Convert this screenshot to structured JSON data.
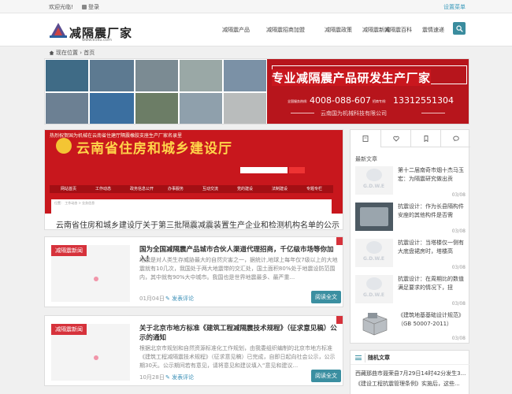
{
  "topbar": {
    "welcome": "欢迎光临!",
    "login": "登录",
    "settings_menu": "设置菜单"
  },
  "logo": {
    "site_name": "减隔震厂家",
    "url_text": "www.e5ku.com"
  },
  "nav": {
    "items": [
      "减隔震产品",
      "减隔震招商加盟",
      "减隔震政策",
      "减隔震新闻",
      "减隔震百科",
      "震情速递"
    ]
  },
  "breadcrumb": {
    "prefix": "现在位置",
    "home": "首页"
  },
  "banner": {
    "headline": "专业减隔震产品研发生产厂家",
    "phone_label_1": "全国服务热线:",
    "phone_1": "4008-088-607",
    "phone_label_2": "招商专线:",
    "phone_2": "13312551304",
    "company": "云南国为机械科技有限公司"
  },
  "featured": {
    "image_top_text": "热烈祝贺国为机械在云南省住建厅隔震橡胶支座生产厂家名录里",
    "image_gov_text": "云南省住房和城乡建设厅",
    "image_menu": [
      "网站首页",
      "工作动态",
      "政务信息公开",
      "办事服务",
      "互动交流",
      "党的建设",
      "法制建设",
      "专题专栏"
    ],
    "image_crumb": "位置： 工作动态 > 业务信息",
    "title": "云南省住房和城乡建设厅关于第三批隔震减震装置生产企业和检测机构名单的公示"
  },
  "posts": [
    {
      "category": "减隔震新闻",
      "title": "国为全国减隔震产品城市合伙人渠道代理招商，千亿级市场等你加入!",
      "summary": "地震是对人类生存威胁最大的自然灾害之一，据统计,地球上每年仅7级以上的大地震就有10几次，我国处于两大地震带的交汇处，国土面积80%处于地震设防范围内，其中就有90%大中城市。我国也是世界地震最多、最严重...",
      "date": "01月04日",
      "comment": "发表评论",
      "more": "阅读全文"
    },
    {
      "category": "减隔震新闻",
      "title": "关于北京市地方标准《建筑工程减隔震技术规程》（征求意见稿）公示的通知",
      "summary": "根据北京市规划和自然资源标准化工作规划，由我委组织编制的北京市地方标准《建筑工程减隔震技术规程》（征求意见稿）已完成，自即日起向社会公示，公示期30天。公示期间若有意见，请将意见和建议填入“意见和建议...",
      "date": "10月28日",
      "comment": "发表评论",
      "more": "阅读全文"
    }
  ],
  "sidebar": {
    "tabs": [
      "document-icon",
      "heart-icon",
      "bookmark-icon",
      "comment-icon"
    ],
    "heading": "最新文章",
    "items": [
      {
        "title": "第十二届南奇市烟十杰马玉宏：为隔震研究做出贡",
        "date": "03/08",
        "pic": "logo"
      },
      {
        "title": "抗震设计：作为长县隔构件安座的其他构件是否需",
        "date": "03/08",
        "pic": "photo"
      },
      {
        "title": "抗震设计：当塔楼仅一侧有大底盘裙房时，塔楼高",
        "date": "03/08",
        "pic": "logo"
      },
      {
        "title": "抗震设计：在周期比的数值满足要求的情况下，扭",
        "date": "03/08",
        "pic": "logo"
      },
      {
        "title": "《建筑地基基础设计规范》（GB 50007-2011）",
        "date": "03/08",
        "pic": "building"
      }
    ]
  },
  "random": {
    "heading": "随机文章",
    "items": [
      "西藏那曲市聂荣县7月29日14时42分发生3...",
      "《建设工程抗震管理条例》实施后，这些..."
    ]
  },
  "colors": {
    "accent": "#3a8fa1",
    "red": "#c8171d",
    "category_red": "#d6323b"
  }
}
